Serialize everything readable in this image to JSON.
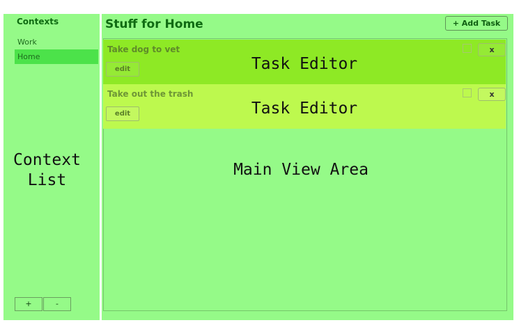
{
  "sidebar": {
    "title": "Contexts",
    "items": [
      {
        "label": "Work",
        "selected": false
      },
      {
        "label": "Home",
        "selected": true
      }
    ],
    "overlay_label": "Context\nList",
    "add_label": "+",
    "remove_label": "-"
  },
  "main": {
    "title": "Stuff for Home",
    "add_task_label": "+ Add Task",
    "view_label": "Main View Area",
    "tasks": [
      {
        "title": "Take dog to vet",
        "overlay_label": "Task Editor",
        "edit_label": "edit",
        "delete_label": "x",
        "completed": false
      },
      {
        "title": "Take out the trash",
        "overlay_label": "Task Editor",
        "edit_label": "edit",
        "delete_label": "x",
        "completed": false
      }
    ]
  },
  "colors": {
    "panel_bg": "#95fa88",
    "selected_context": "#4ce24a",
    "task_1_bg": "#8ee925",
    "task_2_bg": "#bdf94e",
    "title_text": "#0f6b12"
  }
}
